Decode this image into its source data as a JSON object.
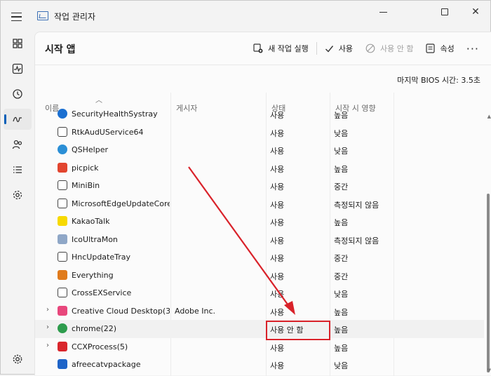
{
  "window": {
    "title": "작업 관리자"
  },
  "page": {
    "title": "시작 앱"
  },
  "toolbar": {
    "new_task": "새 작업 실행",
    "enable": "사용",
    "disable": "사용 안 함",
    "properties": "속성"
  },
  "bios": {
    "label": "마지막 BIOS 시간:",
    "value": "3.5초"
  },
  "table": {
    "headers": {
      "name": "이름",
      "publisher": "게시자",
      "status": "상태",
      "impact": "시작 시 영향"
    },
    "rows": [
      {
        "name": "SecurityHealthSystray",
        "publisher": "",
        "status": "사용",
        "impact": "높음",
        "icon": "shield-icon",
        "color": "#1a6fd1"
      },
      {
        "name": "RtkAudUService64",
        "publisher": "",
        "status": "사용",
        "impact": "낮음",
        "icon": "app-window-icon",
        "color": "#ffffff"
      },
      {
        "name": "QSHelper",
        "publisher": "",
        "status": "사용",
        "impact": "낮음",
        "icon": "qshelper-icon",
        "color": "#2b8fd6"
      },
      {
        "name": "picpick",
        "publisher": "",
        "status": "사용",
        "impact": "높음",
        "icon": "picpick-icon",
        "color": "#e2452f"
      },
      {
        "name": "MiniBin",
        "publisher": "",
        "status": "사용",
        "impact": "중간",
        "icon": "trash-icon",
        "color": "#ffffff"
      },
      {
        "name": "MicrosoftEdgeUpdateCore",
        "publisher": "",
        "status": "사용",
        "impact": "측정되지 않음",
        "icon": "app-window-icon",
        "color": "#ffffff"
      },
      {
        "name": "KakaoTalk",
        "publisher": "",
        "status": "사용",
        "impact": "높음",
        "icon": "kakaotalk-icon",
        "color": "#f7d900"
      },
      {
        "name": "IcoUltraMon",
        "publisher": "",
        "status": "사용",
        "impact": "측정되지 않음",
        "icon": "monitor-icon",
        "color": "#8fa7c7"
      },
      {
        "name": "HncUpdateTray",
        "publisher": "",
        "status": "사용",
        "impact": "중간",
        "icon": "app-window-icon",
        "color": "#ffffff"
      },
      {
        "name": "Everything",
        "publisher": "",
        "status": "사용",
        "impact": "중간",
        "icon": "search-icon",
        "color": "#e07b1c"
      },
      {
        "name": "CrossEXService",
        "publisher": "",
        "status": "사용",
        "impact": "낮음",
        "icon": "app-window-icon",
        "color": "#ffffff"
      },
      {
        "name": "Creative Cloud Desktop(3...",
        "publisher": "Adobe Inc.",
        "status": "사용",
        "impact": "높음",
        "icon": "creative-cloud-icon",
        "color": "#e8477c",
        "expandable": true
      },
      {
        "name": "chrome(22)",
        "publisher": "",
        "status": "사용 안 함",
        "impact": "높음",
        "icon": "chrome-icon",
        "color": "#2e9c4d",
        "expandable": true,
        "highlighted": true
      },
      {
        "name": "CCXProcess(5)",
        "publisher": "",
        "status": "사용",
        "impact": "높음",
        "icon": "adobe-icon",
        "color": "#d9262c",
        "expandable": true
      },
      {
        "name": "afreecatvpackage",
        "publisher": "",
        "status": "사용",
        "impact": "낮음",
        "icon": "afreecatv-icon",
        "color": "#1e64c8"
      }
    ]
  },
  "colors": {
    "accent": "#005fb8",
    "callout": "#d9222a"
  }
}
